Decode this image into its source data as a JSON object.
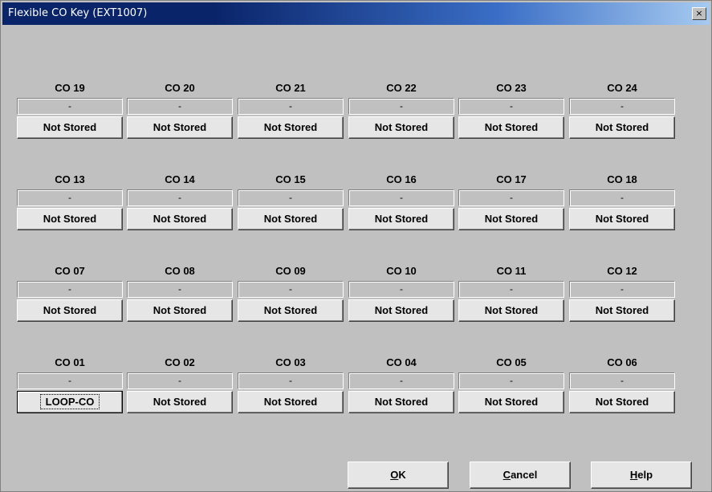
{
  "window": {
    "title": "Flexible CO Key (EXT1007)",
    "close_glyph": "×"
  },
  "rows": [
    [
      {
        "label": "CO 19",
        "value": "-",
        "button": "Not Stored"
      },
      {
        "label": "CO 20",
        "value": "-",
        "button": "Not Stored"
      },
      {
        "label": "CO 21",
        "value": "-",
        "button": "Not Stored"
      },
      {
        "label": "CO 22",
        "value": "-",
        "button": "Not Stored"
      },
      {
        "label": "CO 23",
        "value": "-",
        "button": "Not Stored"
      },
      {
        "label": "CO 24",
        "value": "-",
        "button": "Not Stored"
      }
    ],
    [
      {
        "label": "CO 13",
        "value": "-",
        "button": "Not Stored"
      },
      {
        "label": "CO 14",
        "value": "-",
        "button": "Not Stored"
      },
      {
        "label": "CO 15",
        "value": "-",
        "button": "Not Stored"
      },
      {
        "label": "CO 16",
        "value": "-",
        "button": "Not Stored"
      },
      {
        "label": "CO 17",
        "value": "-",
        "button": "Not Stored"
      },
      {
        "label": "CO 18",
        "value": "-",
        "button": "Not Stored"
      }
    ],
    [
      {
        "label": "CO 07",
        "value": "-",
        "button": "Not Stored"
      },
      {
        "label": "CO 08",
        "value": "-",
        "button": "Not Stored"
      },
      {
        "label": "CO 09",
        "value": "-",
        "button": "Not Stored"
      },
      {
        "label": "CO 10",
        "value": "-",
        "button": "Not Stored"
      },
      {
        "label": "CO 11",
        "value": "-",
        "button": "Not Stored"
      },
      {
        "label": "CO 12",
        "value": "-",
        "button": "Not Stored"
      }
    ],
    [
      {
        "label": "CO 01",
        "value": "-",
        "button": "LOOP-CO"
      },
      {
        "label": "CO 02",
        "value": "-",
        "button": "Not Stored"
      },
      {
        "label": "CO 03",
        "value": "-",
        "button": "Not Stored"
      },
      {
        "label": "CO 04",
        "value": "-",
        "button": "Not Stored"
      },
      {
        "label": "CO 05",
        "value": "-",
        "button": "Not Stored"
      },
      {
        "label": "CO 06",
        "value": "-",
        "button": "Not Stored"
      }
    ]
  ],
  "buttons": {
    "ok": {
      "mnemonic": "O",
      "rest": "K"
    },
    "cancel": {
      "mnemonic": "C",
      "rest": "ancel"
    },
    "help": {
      "mnemonic": "H",
      "rest": "elp"
    }
  }
}
